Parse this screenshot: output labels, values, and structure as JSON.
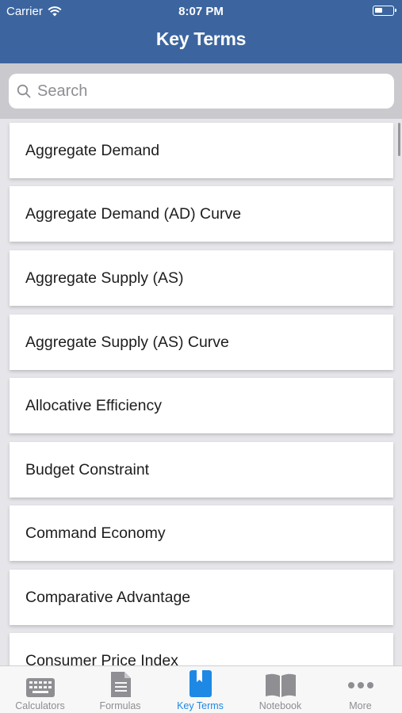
{
  "status": {
    "carrier": "Carrier",
    "time": "8:07 PM"
  },
  "header": {
    "title": "Key Terms"
  },
  "search": {
    "placeholder": "Search"
  },
  "terms": [
    "Aggregate Demand",
    "Aggregate Demand (AD) Curve",
    "Aggregate Supply (AS)",
    "Aggregate Supply (AS) Curve",
    "Allocative Efficiency",
    "Budget Constraint",
    "Command Economy",
    "Comparative Advantage",
    "Consumer Price Index"
  ],
  "tabs": [
    {
      "label": "Calculators",
      "icon": "keyboard-icon"
    },
    {
      "label": "Formulas",
      "icon": "document-icon"
    },
    {
      "label": "Key Terms",
      "icon": "bookmark-icon",
      "active": true
    },
    {
      "label": "Notebook",
      "icon": "book-icon"
    },
    {
      "label": "More",
      "icon": "more-dots-icon"
    }
  ],
  "colors": {
    "header": "#3c659f",
    "active_tab": "#1e88e5",
    "inactive_tab": "#8e8e93"
  }
}
